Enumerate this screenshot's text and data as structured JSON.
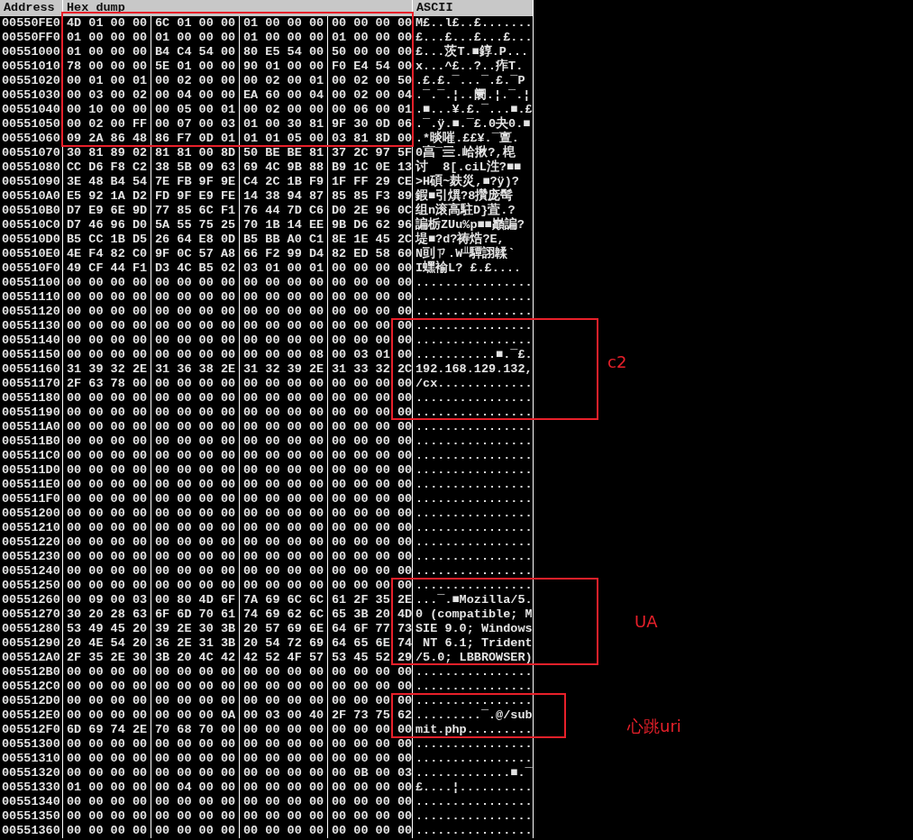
{
  "table": {
    "columns": [
      "Address",
      "Hex dump",
      "ASCII"
    ],
    "rows": [
      {
        "address": "00550FE0",
        "hex": [
          "4D 01 00 00",
          "6C 01 00 00",
          "01 00 00 00",
          "00 00 00 00"
        ],
        "ascii": "M£..l£..£......."
      },
      {
        "address": "00550FF0",
        "hex": [
          "01 00 00 00",
          "01 00 00 00",
          "01 00 00 00",
          "01 00 00 00"
        ],
        "ascii": "£...£...£...£..."
      },
      {
        "address": "00551000",
        "hex": [
          "01 00 00 00",
          "B4 C4 54 00",
          "80 E5 54 00",
          "50 00 00 00"
        ],
        "ascii": "£...茨T.■錞.P..."
      },
      {
        "address": "00551010",
        "hex": [
          "78 00 00 00",
          "5E 01 00 00",
          "90 01 00 00",
          "F0 E4 54 00"
        ],
        "ascii": "x...^£..?..痄T."
      },
      {
        "address": "00551020",
        "hex": [
          "00 01 00 01",
          "00 02 00 00",
          "00 02 00 01",
          "00 02 00 50"
        ],
        "ascii": ".£.£.¯...¯.£.¯P"
      },
      {
        "address": "00551030",
        "hex": [
          "00 03 00 02",
          "00 04 00 00",
          "EA 60 00 04",
          "00 02 00 04"
        ],
        "ascii": ".¯.¯.¦..阛.¦.¯.¦"
      },
      {
        "address": "00551040",
        "hex": [
          "00 10 00 00",
          "00 05 00 01",
          "00 02 00 00",
          "00 06 00 01"
        ],
        "ascii": ".■...¥.£.¯...■.£"
      },
      {
        "address": "00551050",
        "hex": [
          "00 02 00 FF",
          "00 07 00 03",
          "01 00 30 81",
          "9F 30 0D 06"
        ],
        "ascii": ".¯.ÿ.■.¯£.0夬0.■"
      },
      {
        "address": "00551060",
        "hex": [
          "09 2A 86 48",
          "86 F7 0D 01",
          "01 01 05 00",
          "03 81 8D 00"
        ],
        "ascii": ".*晱嗺.££¥.¯亶."
      },
      {
        "address": "00551070",
        "hex": [
          "30 81 89 02",
          "81 81 00 8D",
          "50 BE BE 81",
          "37 2C 97 5F"
        ],
        "ascii": "0亯¯亖.峆揪?,梍"
      },
      {
        "address": "00551080",
        "hex": [
          "CC D6 F8 C2",
          "38 5B 09 63",
          "69 4C 9B 88",
          "B9 1C 0E 13"
        ],
        "ascii": "讨  8[.ciL泩?■■"
      },
      {
        "address": "00551090",
        "hex": [
          "3E 48 B4 54",
          "7E FB 9F 9E",
          "C4 2C 1B F9",
          "1F FF 29 CE"
        ],
        "ascii": ">H碩~麸災,■?ÿ)?"
      },
      {
        "address": "005510A0",
        "hex": [
          "E5 92 1A D2",
          "FD 9F E9 FE",
          "14 38 94 87",
          "85 85 F3 89"
        ],
        "ascii": "鍜■引熼?8攢庞髩"
      },
      {
        "address": "005510B0",
        "hex": [
          "D7 E9 6E 9D",
          "77 85 6C F1",
          "76 44 7D C6",
          "D0 2E 96 0C"
        ],
        "ascii": "组n滚高駐D}萓.?"
      },
      {
        "address": "005510C0",
        "hex": [
          "D7 46 96 D0",
          "5A 55 75 25",
          "70 1B 14 EE",
          "9B D6 62 96"
        ],
        "ascii": "諞栃ZUu%p■■巓諞?"
      },
      {
        "address": "005510D0",
        "hex": [
          "B5 CC 1B D5",
          "26 64 E8 0D",
          "B5 BB A0 C1",
          "8E 1E 45 2C"
        ],
        "ascii": "堤■?d?祷焅?E,"
      },
      {
        "address": "005510E0",
        "hex": [
          "4E F4 82 C0",
          "9F 0C 57 A8",
          "66 F2 99 D4",
          "82 ED 58 60"
        ],
        "ascii": "N刯ㄗ.W╨驔詡韖`"
      },
      {
        "address": "005510F0",
        "hex": [
          "49 CF 44 F1",
          "D3 4C B5 02",
          "03 01 00 01",
          "00 00 00 00"
        ],
        "ascii": "I蟔褕L? £.£...."
      },
      {
        "address": "00551100",
        "hex": [
          "00 00 00 00",
          "00 00 00 00",
          "00 00 00 00",
          "00 00 00 00"
        ],
        "ascii": "................"
      },
      {
        "address": "00551110",
        "hex": [
          "00 00 00 00",
          "00 00 00 00",
          "00 00 00 00",
          "00 00 00 00"
        ],
        "ascii": "................"
      },
      {
        "address": "00551120",
        "hex": [
          "00 00 00 00",
          "00 00 00 00",
          "00 00 00 00",
          "00 00 00 00"
        ],
        "ascii": "................"
      },
      {
        "address": "00551130",
        "hex": [
          "00 00 00 00",
          "00 00 00 00",
          "00 00 00 00",
          "00 00 00 00"
        ],
        "ascii": "................"
      },
      {
        "address": "00551140",
        "hex": [
          "00 00 00 00",
          "00 00 00 00",
          "00 00 00 00",
          "00 00 00 00"
        ],
        "ascii": "................"
      },
      {
        "address": "00551150",
        "hex": [
          "00 00 00 00",
          "00 00 00 00",
          "00 00 00 08",
          "00 03 01 00"
        ],
        "ascii": "...........■.¯£."
      },
      {
        "address": "00551160",
        "hex": [
          "31 39 32 2E",
          "31 36 38 2E",
          "31 32 39 2E",
          "31 33 32 2C"
        ],
        "ascii": "192.168.129.132,"
      },
      {
        "address": "00551170",
        "hex": [
          "2F 63 78 00",
          "00 00 00 00",
          "00 00 00 00",
          "00 00 00 00"
        ],
        "ascii": "/cx............."
      },
      {
        "address": "00551180",
        "hex": [
          "00 00 00 00",
          "00 00 00 00",
          "00 00 00 00",
          "00 00 00 00"
        ],
        "ascii": "................"
      },
      {
        "address": "00551190",
        "hex": [
          "00 00 00 00",
          "00 00 00 00",
          "00 00 00 00",
          "00 00 00 00"
        ],
        "ascii": "................"
      },
      {
        "address": "005511A0",
        "hex": [
          "00 00 00 00",
          "00 00 00 00",
          "00 00 00 00",
          "00 00 00 00"
        ],
        "ascii": "................"
      },
      {
        "address": "005511B0",
        "hex": [
          "00 00 00 00",
          "00 00 00 00",
          "00 00 00 00",
          "00 00 00 00"
        ],
        "ascii": "................"
      },
      {
        "address": "005511C0",
        "hex": [
          "00 00 00 00",
          "00 00 00 00",
          "00 00 00 00",
          "00 00 00 00"
        ],
        "ascii": "................"
      },
      {
        "address": "005511D0",
        "hex": [
          "00 00 00 00",
          "00 00 00 00",
          "00 00 00 00",
          "00 00 00 00"
        ],
        "ascii": "................"
      },
      {
        "address": "005511E0",
        "hex": [
          "00 00 00 00",
          "00 00 00 00",
          "00 00 00 00",
          "00 00 00 00"
        ],
        "ascii": "................"
      },
      {
        "address": "005511F0",
        "hex": [
          "00 00 00 00",
          "00 00 00 00",
          "00 00 00 00",
          "00 00 00 00"
        ],
        "ascii": "................"
      },
      {
        "address": "00551200",
        "hex": [
          "00 00 00 00",
          "00 00 00 00",
          "00 00 00 00",
          "00 00 00 00"
        ],
        "ascii": "................"
      },
      {
        "address": "00551210",
        "hex": [
          "00 00 00 00",
          "00 00 00 00",
          "00 00 00 00",
          "00 00 00 00"
        ],
        "ascii": "................"
      },
      {
        "address": "00551220",
        "hex": [
          "00 00 00 00",
          "00 00 00 00",
          "00 00 00 00",
          "00 00 00 00"
        ],
        "ascii": "................"
      },
      {
        "address": "00551230",
        "hex": [
          "00 00 00 00",
          "00 00 00 00",
          "00 00 00 00",
          "00 00 00 00"
        ],
        "ascii": "................"
      },
      {
        "address": "00551240",
        "hex": [
          "00 00 00 00",
          "00 00 00 00",
          "00 00 00 00",
          "00 00 00 00"
        ],
        "ascii": "................"
      },
      {
        "address": "00551250",
        "hex": [
          "00 00 00 00",
          "00 00 00 00",
          "00 00 00 00",
          "00 00 00 00"
        ],
        "ascii": "................"
      },
      {
        "address": "00551260",
        "hex": [
          "00 09 00 03",
          "00 80 4D 6F",
          "7A 69 6C 6C",
          "61 2F 35 2E"
        ],
        "ascii": "...¯.■Mozilla/5."
      },
      {
        "address": "00551270",
        "hex": [
          "30 20 28 63",
          "6F 6D 70 61",
          "74 69 62 6C",
          "65 3B 20 4D"
        ],
        "ascii": "0 (compatible; M"
      },
      {
        "address": "00551280",
        "hex": [
          "53 49 45 20",
          "39 2E 30 3B",
          "20 57 69 6E",
          "64 6F 77 73"
        ],
        "ascii": "SIE 9.0; Windows"
      },
      {
        "address": "00551290",
        "hex": [
          "20 4E 54 20",
          "36 2E 31 3B",
          "20 54 72 69",
          "64 65 6E 74"
        ],
        "ascii": " NT 6.1; Trident"
      },
      {
        "address": "005512A0",
        "hex": [
          "2F 35 2E 30",
          "3B 20 4C 42",
          "42 52 4F 57",
          "53 45 52 29"
        ],
        "ascii": "/5.0; LBBROWSER)"
      },
      {
        "address": "005512B0",
        "hex": [
          "00 00 00 00",
          "00 00 00 00",
          "00 00 00 00",
          "00 00 00 00"
        ],
        "ascii": "................"
      },
      {
        "address": "005512C0",
        "hex": [
          "00 00 00 00",
          "00 00 00 00",
          "00 00 00 00",
          "00 00 00 00"
        ],
        "ascii": "................"
      },
      {
        "address": "005512D0",
        "hex": [
          "00 00 00 00",
          "00 00 00 00",
          "00 00 00 00",
          "00 00 00 00"
        ],
        "ascii": "................"
      },
      {
        "address": "005512E0",
        "hex": [
          "00 00 00 00",
          "00 00 00 0A",
          "00 03 00 40",
          "2F 73 75 62"
        ],
        "ascii": ".........¯.@/sub"
      },
      {
        "address": "005512F0",
        "hex": [
          "6D 69 74 2E",
          "70 68 70 00",
          "00 00 00 00",
          "00 00 00 00"
        ],
        "ascii": "mit.php........."
      },
      {
        "address": "00551300",
        "hex": [
          "00 00 00 00",
          "00 00 00 00",
          "00 00 00 00",
          "00 00 00 00"
        ],
        "ascii": "................"
      },
      {
        "address": "00551310",
        "hex": [
          "00 00 00 00",
          "00 00 00 00",
          "00 00 00 00",
          "00 00 00 00"
        ],
        "ascii": "................"
      },
      {
        "address": "00551320",
        "hex": [
          "00 00 00 00",
          "00 00 00 00",
          "00 00 00 00",
          "00 0B 00 03"
        ],
        "ascii": ".............■.¯"
      },
      {
        "address": "00551330",
        "hex": [
          "01 00 00 00",
          "00 04 00 00",
          "00 00 00 00",
          "00 00 00 00"
        ],
        "ascii": "£....¦.........."
      },
      {
        "address": "00551340",
        "hex": [
          "00 00 00 00",
          "00 00 00 00",
          "00 00 00 00",
          "00 00 00 00"
        ],
        "ascii": "................"
      },
      {
        "address": "00551350",
        "hex": [
          "00 00 00 00",
          "00 00 00 00",
          "00 00 00 00",
          "00 00 00 00"
        ],
        "ascii": "................"
      },
      {
        "address": "00551360",
        "hex": [
          "00 00 00 00",
          "00 00 00 00",
          "00 00 00 00",
          "00 00 00 00"
        ],
        "ascii": "................"
      }
    ]
  },
  "annotations": [
    {
      "label": "c2"
    },
    {
      "label": "UA"
    },
    {
      "label": "心跳uri"
    }
  ]
}
